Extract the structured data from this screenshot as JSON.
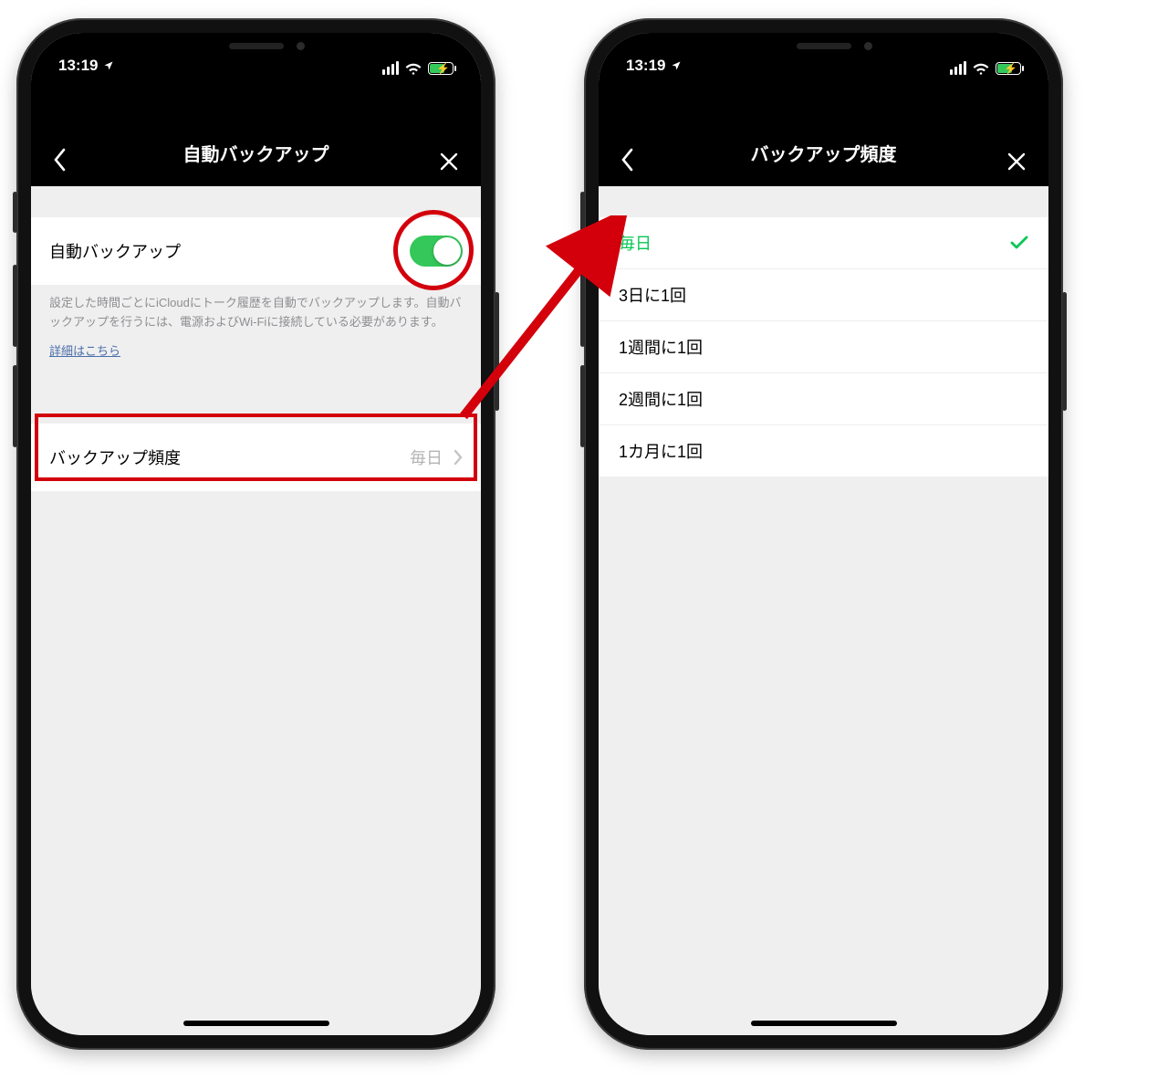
{
  "status": {
    "time": "13:19"
  },
  "left": {
    "title": "自動バックアップ",
    "toggle_label": "自動バックアップ",
    "toggle_on": true,
    "description": "設定した時間ごとにiCloudにトーク履歴を自動でバックアップします。自動バックアップを行うには、電源およびWi-Fiに接続している必要があります。",
    "details_link": "詳細はこちら",
    "freq_label": "バックアップ頻度",
    "freq_value": "毎日"
  },
  "right": {
    "title": "バックアップ頻度",
    "options": [
      {
        "label": "毎日",
        "selected": true
      },
      {
        "label": "3日に1回",
        "selected": false
      },
      {
        "label": "1週間に1回",
        "selected": false
      },
      {
        "label": "2週間に1回",
        "selected": false
      },
      {
        "label": "1カ月に1回",
        "selected": false
      }
    ]
  },
  "colors": {
    "annotation_red": "#d3000c",
    "toggle_green": "#34c759",
    "brand_green": "#06c755"
  }
}
